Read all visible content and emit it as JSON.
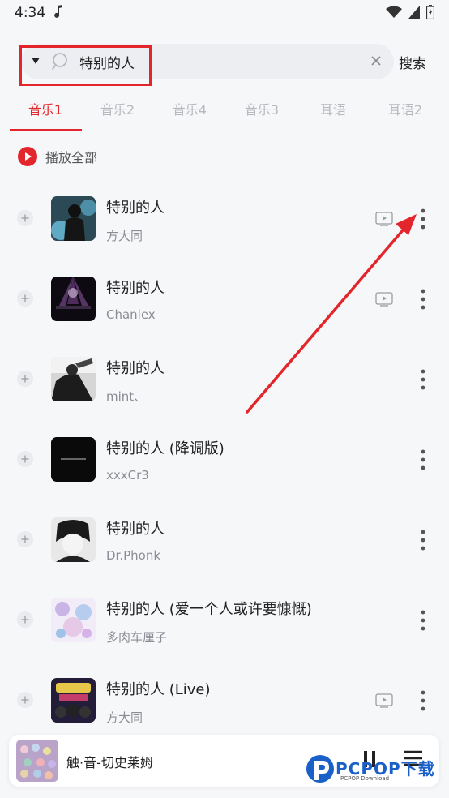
{
  "status_bar": {
    "time": "4:34"
  },
  "search": {
    "query": "特别的人",
    "button_label": "搜索"
  },
  "tabs": [
    {
      "label": "音乐1",
      "active": true
    },
    {
      "label": "音乐2",
      "active": false
    },
    {
      "label": "音乐4",
      "active": false
    },
    {
      "label": "音乐3",
      "active": false
    },
    {
      "label": "耳语",
      "active": false
    },
    {
      "label": "耳语2",
      "active": false
    }
  ],
  "play_all": {
    "label": "播放全部",
    "icon": "play-circle-icon"
  },
  "songs": [
    {
      "title": "特别的人",
      "artist": "方大同",
      "has_mv": true
    },
    {
      "title": "特别的人",
      "artist": "Chanlex",
      "has_mv": true
    },
    {
      "title": "特别的人",
      "artist": "mint、",
      "has_mv": false
    },
    {
      "title": "特别的人 (降调版)",
      "artist": "xxxCr3",
      "has_mv": false
    },
    {
      "title": "特别的人",
      "artist": "Dr.Phonk",
      "has_mv": false
    },
    {
      "title": "特别的人 (爱一个人或许要慷慨)",
      "artist": "多肉车厘子",
      "has_mv": false
    },
    {
      "title": "特别的人 (Live)",
      "artist": "方大同",
      "has_mv": true
    }
  ],
  "mini_player": {
    "title": "触·音-切史莱姆"
  },
  "watermark": {
    "text": "PCPOP下载",
    "sub": "PCPOP Download"
  },
  "colors": {
    "accent": "#e3262c",
    "background": "#f6f7f9",
    "tab_inactive": "#b7b9be"
  }
}
